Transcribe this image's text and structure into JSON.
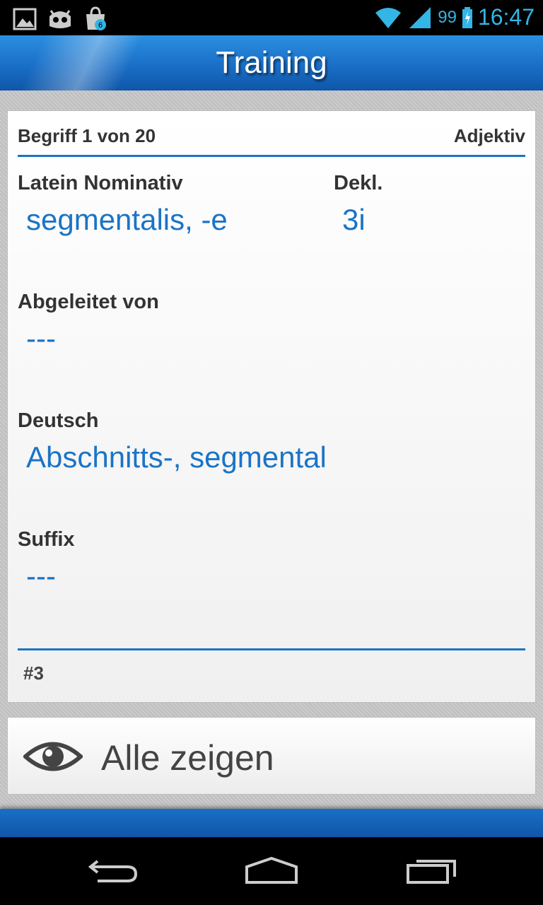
{
  "status_bar": {
    "battery": "99",
    "time": "16:47",
    "accent": "#33b5e5",
    "icons": [
      "gallery-icon",
      "cyanogen-icon",
      "store-update-icon",
      "wifi-icon",
      "signal-icon",
      "battery-icon"
    ],
    "store_badge": "6"
  },
  "action_bar": {
    "title": "Training"
  },
  "card": {
    "term_counter": "Begriff 1 von 20",
    "word_type": "Adjektiv",
    "latin_label": "Latein Nominativ",
    "latin_value": "segmentalis, -e",
    "decl_label": "Dekl.",
    "decl_value": "3i",
    "derived_label": "Abgeleitet von",
    "derived_value": "---",
    "german_label": "Deutsch",
    "german_value": "Abschnitts-, segmental",
    "suffix_label": "Suffix",
    "suffix_value": "---",
    "footer": "#3"
  },
  "show_all_button": {
    "label": "Alle zeigen",
    "icon": "eye-icon"
  },
  "navigation": {
    "icons": [
      "back-icon",
      "home-icon",
      "recents-icon"
    ]
  },
  "colors": {
    "brand_blue": "#1a74c6",
    "status_accent": "#33b5e5"
  }
}
